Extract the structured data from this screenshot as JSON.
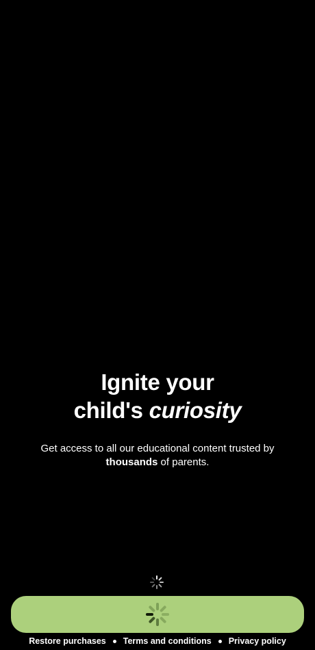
{
  "hero": {
    "headline_line1": "Ignite your",
    "headline_line2_prefix": "child's ",
    "headline_line2_emphasis": "curiosity",
    "subtitle_prefix": "Get access to all our educational content trusted by ",
    "subtitle_bold": "thousands",
    "subtitle_suffix": " of parents."
  },
  "loading": {
    "small_spinner_icon": "loading-spinner-icon"
  },
  "cta": {
    "state": "loading",
    "spinner_icon": "loading-spinner-icon",
    "color": "#acd07c"
  },
  "footer": {
    "restore_label": "Restore purchases",
    "terms_label": "Terms and conditions",
    "privacy_label": "Privacy policy"
  },
  "colors": {
    "background": "#000000",
    "text": "#ffffff",
    "accent": "#acd07c"
  }
}
